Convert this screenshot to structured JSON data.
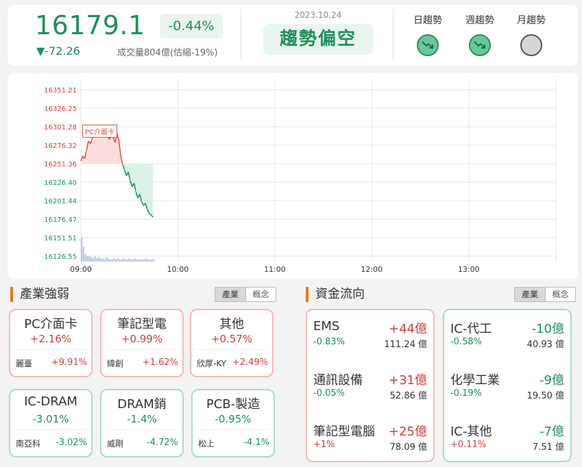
{
  "header": {
    "index_value": "16179.1",
    "change_pct": "-0.44%",
    "change_pts": "▼-72.26",
    "volume": "成交量804億(估縮-19%)",
    "date": "2023.10.24",
    "trend_label": "趨勢偏空",
    "trends": [
      {
        "label": "日趨勢",
        "icon": "trend-down-icon"
      },
      {
        "label": "週趨勢",
        "icon": "trend-down-icon"
      },
      {
        "label": "月趨勢",
        "icon": "neutral-circle-icon"
      }
    ]
  },
  "chart_data": {
    "type": "line",
    "y_ticks": [
      "16351.21",
      "16326.25",
      "16301.28",
      "16276.32",
      "16251.36",
      "16226.40",
      "16201.44",
      "16176.47",
      "16151.51",
      "16126.55"
    ],
    "ylim": [
      16126.55,
      16351.21
    ],
    "reference": 16251.36,
    "x_ticks": [
      "09:00",
      "10:00",
      "11:00",
      "12:00",
      "13:00"
    ],
    "annotation": "PC介面卡",
    "grid": true,
    "series": [
      {
        "values": [
          16255,
          16262,
          16258,
          16270,
          16282,
          16278,
          16285,
          16293,
          16289,
          16296,
          16292,
          16287,
          16292,
          16298,
          16290,
          16284,
          16290,
          16287,
          16280,
          16292,
          16283,
          16262,
          16250,
          16243,
          16235,
          16240,
          16228,
          16220,
          16225,
          16213,
          16205,
          16210,
          16200,
          16195,
          16198,
          16190,
          16184,
          16182,
          16179
        ]
      }
    ],
    "volume": [
      22,
      14,
      7,
      5,
      5,
      4,
      3,
      5,
      3,
      4,
      3,
      3,
      2,
      4,
      3,
      2,
      2,
      3,
      2,
      3,
      2,
      2,
      3,
      2,
      2,
      3,
      2,
      2,
      3,
      2,
      2,
      2,
      2,
      2,
      3,
      2,
      2,
      2,
      2
    ]
  },
  "industry": {
    "title": "產業強弱",
    "tabs": [
      "產業",
      "概念"
    ],
    "cards": [
      {
        "name": "PC介面卡",
        "pct": "+2.16%",
        "stock": "麗臺",
        "stock_pct": "+9.91%",
        "color": "red"
      },
      {
        "name": "筆記型電",
        "pct": "+0.99%",
        "stock": "緯創",
        "stock_pct": "+1.62%",
        "color": "red"
      },
      {
        "name": "其他",
        "pct": "+0.57%",
        "stock": "欣厚-KY",
        "stock_pct": "+2.49%",
        "color": "red"
      },
      {
        "name": "IC-DRAM",
        "pct": "-3.01%",
        "stock": "南亞科",
        "stock_pct": "-3.02%",
        "color": "green"
      },
      {
        "name": "DRAM銷",
        "pct": "-1.4%",
        "stock": "威剛",
        "stock_pct": "-4.72%",
        "color": "green"
      },
      {
        "name": "PCB-製造",
        "pct": "-0.95%",
        "stock": "松上",
        "stock_pct": "-4.1%",
        "color": "green"
      }
    ]
  },
  "fund": {
    "title": "資金流向",
    "tabs": [
      "產業",
      "概念"
    ],
    "inflow": [
      {
        "name": "EMS",
        "amount": "+44億",
        "pct": "-0.83%",
        "value": "111.24 億"
      },
      {
        "name": "通訊設備",
        "amount": "+31億",
        "pct": "-0.05%",
        "value": "52.86 億"
      },
      {
        "name": "筆記型電腦",
        "amount": "+25億",
        "pct": "+1%",
        "value": "78.09 億"
      }
    ],
    "outflow": [
      {
        "name": "IC-代工",
        "amount": "-10億",
        "pct": "-0.58%",
        "value": "40.93 億"
      },
      {
        "name": "化學工業",
        "amount": "-9億",
        "pct": "-0.19%",
        "value": "19.50 億"
      },
      {
        "name": "IC-其他",
        "amount": "-7億",
        "pct": "+0.11%",
        "value": "7.51 億"
      }
    ]
  },
  "colors": {
    "up": "#d23c3c",
    "down": "#1e8f5a",
    "accent": "#e8771d"
  }
}
